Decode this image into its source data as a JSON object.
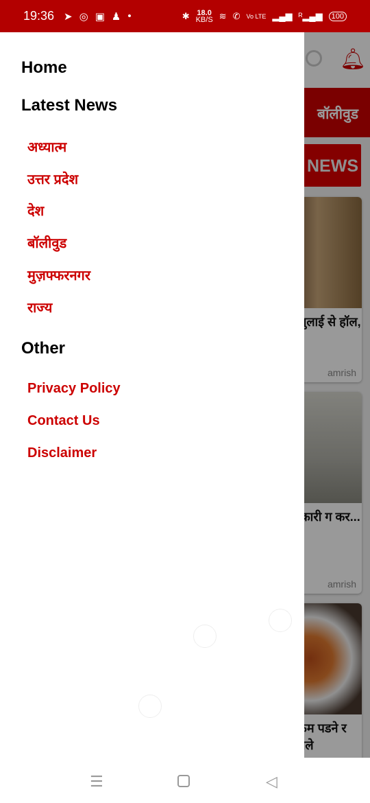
{
  "status": {
    "time": "19:36",
    "speed": "18.0",
    "speed_unit": "KB/S",
    "battery": "100",
    "net": "Vo LTE"
  },
  "background": {
    "tab": "बॉलीवुड",
    "news_label": "NEWS",
    "cards": [
      {
        "title": "जुलाई से हॉल,",
        "author": "amrish"
      },
      {
        "title": "त्कारी ग कर...",
        "author": "amrish"
      },
      {
        "title": "कम पडने र चले",
        "author": ""
      }
    ]
  },
  "drawer": {
    "home": "Home",
    "latest": "Latest News",
    "categories": [
      "अध्यात्म",
      "उत्तर प्रदेश",
      "देश",
      "बॉलीवुड",
      "मुज़फ्फरनगर",
      "राज्य"
    ],
    "other": "Other",
    "links": [
      "Privacy Policy",
      "Contact Us",
      "Disclaimer"
    ]
  },
  "colors": {
    "accent": "#cc0000",
    "status_bar": "#b30000"
  }
}
